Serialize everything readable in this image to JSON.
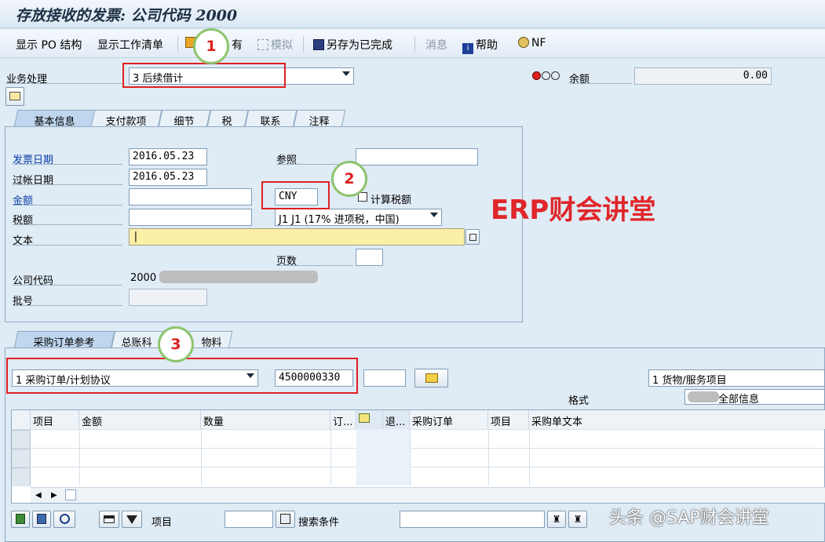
{
  "title": "存放接收的发票: 公司代码 2000",
  "toolbar": {
    "show_po_structure": "显示 PO 结构",
    "show_worklist": "显示工作清单",
    "hold": "有",
    "simulate": "模拟",
    "save_completed": "另存为已完成",
    "messages": "消息",
    "help": "帮助",
    "nf": "NF"
  },
  "header": {
    "transaction_label": "业务处理",
    "transaction_value": "3 后续借计",
    "balance_label": "余额",
    "balance_value": "0.00"
  },
  "tabs_top": [
    "基本信息",
    "支付款项",
    "细节",
    "税",
    "联系",
    "注释"
  ],
  "basic": {
    "invoice_date_label": "发票日期",
    "invoice_date": "2016.05.23",
    "reference_label": "参照",
    "reference": "",
    "posting_date_label": "过帐日期",
    "posting_date": "2016.05.23",
    "amount_label": "金额",
    "amount": "",
    "currency": "CNY",
    "calc_tax_label": "计算税额",
    "tax_label": "税额",
    "tax_amount": "",
    "tax_code": "J1 J1 (17% 进项税，中国)",
    "text_label": "文本",
    "text": "|",
    "pages_label": "页数",
    "pages": "",
    "company_code_label": "公司代码",
    "company_code": "2000",
    "batch_label": "批号",
    "batch": ""
  },
  "watermark_brand": "ERP财会讲堂",
  "annotations": [
    "1",
    "2",
    "3"
  ],
  "tabs_bottom": [
    "采购订单参考",
    "总账科",
    "物料"
  ],
  "po_ref": {
    "ref_type": "1 采购订单/计划协议",
    "po_number": "4500000330",
    "item_field": "",
    "goods_type": "1 货物/服务项目",
    "layout_label": "格式",
    "layout_value": "全部信息"
  },
  "grid": {
    "columns": [
      "项目",
      "金额",
      "数量",
      "订...",
      "",
      "退...",
      "采购订单",
      "项目",
      "采购单文本"
    ],
    "rows": 3
  },
  "footer": {
    "item_label": "项目",
    "item_value": "",
    "search_label": "搜索条件",
    "search_value": ""
  },
  "watermark": "头条 @SAP财会讲堂"
}
